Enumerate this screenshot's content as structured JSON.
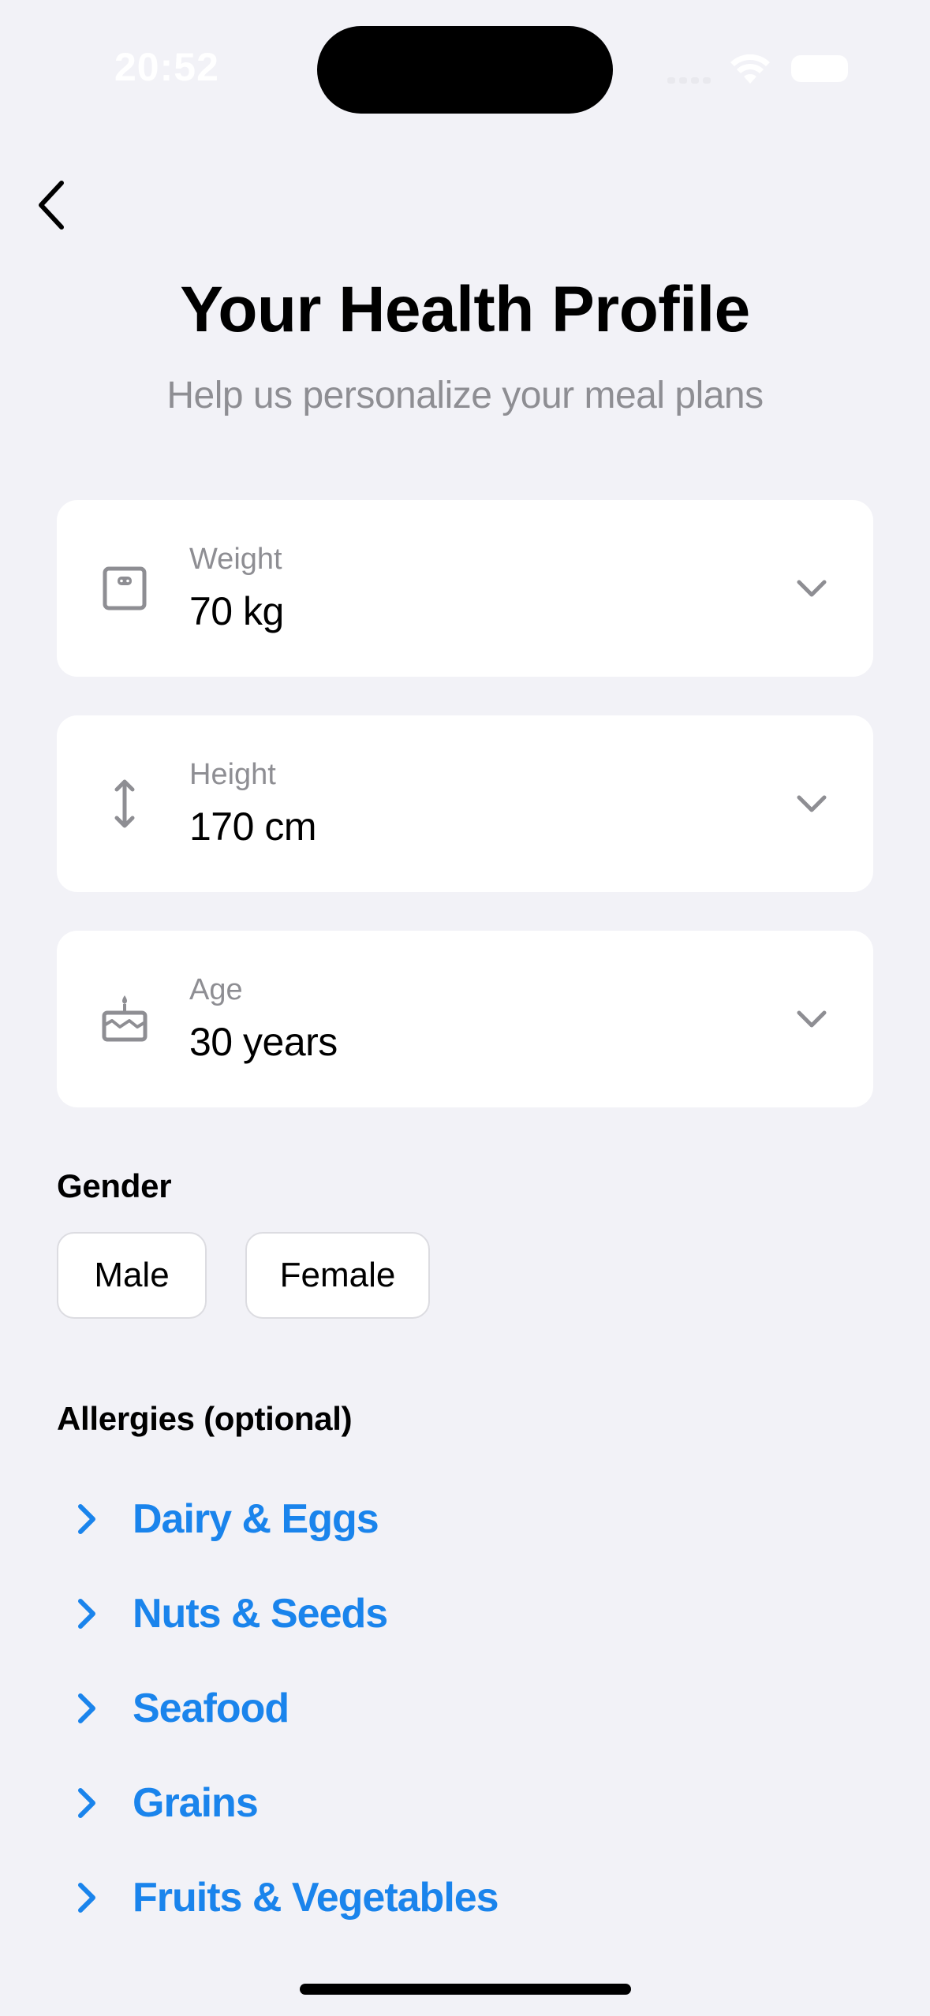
{
  "status_bar": {
    "time": "20:52"
  },
  "header": {
    "back_icon": "chevron-left-icon",
    "title": "Your Health Profile",
    "subtitle": "Help us personalize your meal plans"
  },
  "metrics": [
    {
      "icon": "scale-icon",
      "label": "Weight",
      "value": "70 kg"
    },
    {
      "icon": "height-arrows-icon",
      "label": "Height",
      "value": "170 cm"
    },
    {
      "icon": "birthday-cake-icon",
      "label": "Age",
      "value": "30 years"
    }
  ],
  "gender": {
    "title": "Gender",
    "options": [
      "Male",
      "Female"
    ]
  },
  "allergies": {
    "title": "Allergies (optional)",
    "items": [
      "Dairy & Eggs",
      "Nuts & Seeds",
      "Seafood",
      "Grains",
      "Fruits & Vegetables"
    ]
  },
  "colors": {
    "background": "#f2f2f7",
    "card": "#ffffff",
    "accent": "#1a84ec",
    "secondary_text": "#8e8e93"
  }
}
